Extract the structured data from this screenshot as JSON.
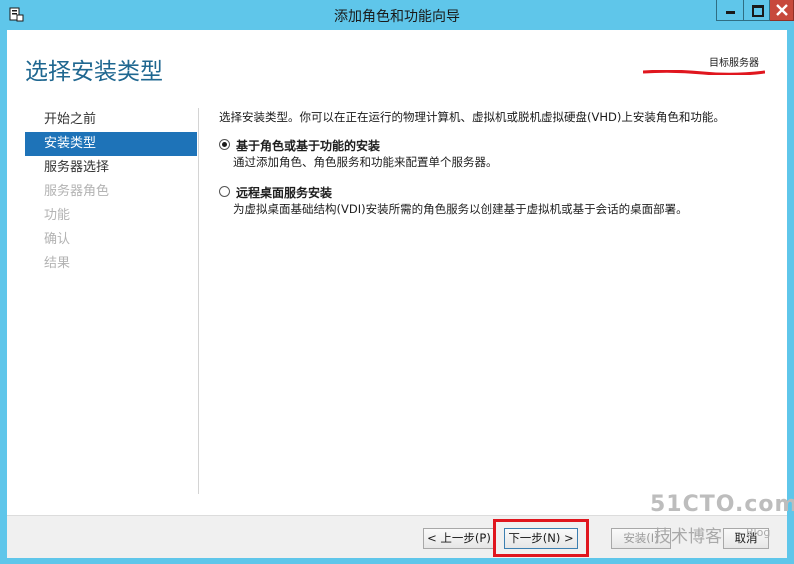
{
  "window": {
    "title": "添加角色和功能向导"
  },
  "header": {
    "page_title": "选择安装类型",
    "destination_label": "目标服务器"
  },
  "nav": {
    "items": [
      {
        "label": "开始之前",
        "state": "normal"
      },
      {
        "label": "安装类型",
        "state": "active"
      },
      {
        "label": "服务器选择",
        "state": "normal"
      },
      {
        "label": "服务器角色",
        "state": "disabled"
      },
      {
        "label": "功能",
        "state": "disabled"
      },
      {
        "label": "确认",
        "state": "disabled"
      },
      {
        "label": "结果",
        "state": "disabled"
      }
    ]
  },
  "content": {
    "intro": "选择安装类型。你可以在正在运行的物理计算机、虚拟机或脱机虚拟硬盘(VHD)上安装角色和功能。",
    "options": [
      {
        "label": "基于角色或基于功能的安装",
        "description": "通过添加角色、角色服务和功能来配置单个服务器。",
        "selected": true
      },
      {
        "label": "远程桌面服务安装",
        "description": "为虚拟桌面基础结构(VDI)安装所需的角色服务以创建基于虚拟机或基于会话的桌面部署。",
        "selected": false
      }
    ]
  },
  "footer": {
    "prev_label": "< 上一步(P)",
    "next_label": "下一步(N) >",
    "install_label": "安装(I)",
    "cancel_label": "取消"
  },
  "watermark": {
    "main": "51CTO.com",
    "sub": "技术博客",
    "blog": "Blog"
  },
  "colors": {
    "titlebar": "#5fc6ea",
    "accent": "#1e73b8",
    "title_text": "#1f6790",
    "highlight": "#e0161e"
  }
}
